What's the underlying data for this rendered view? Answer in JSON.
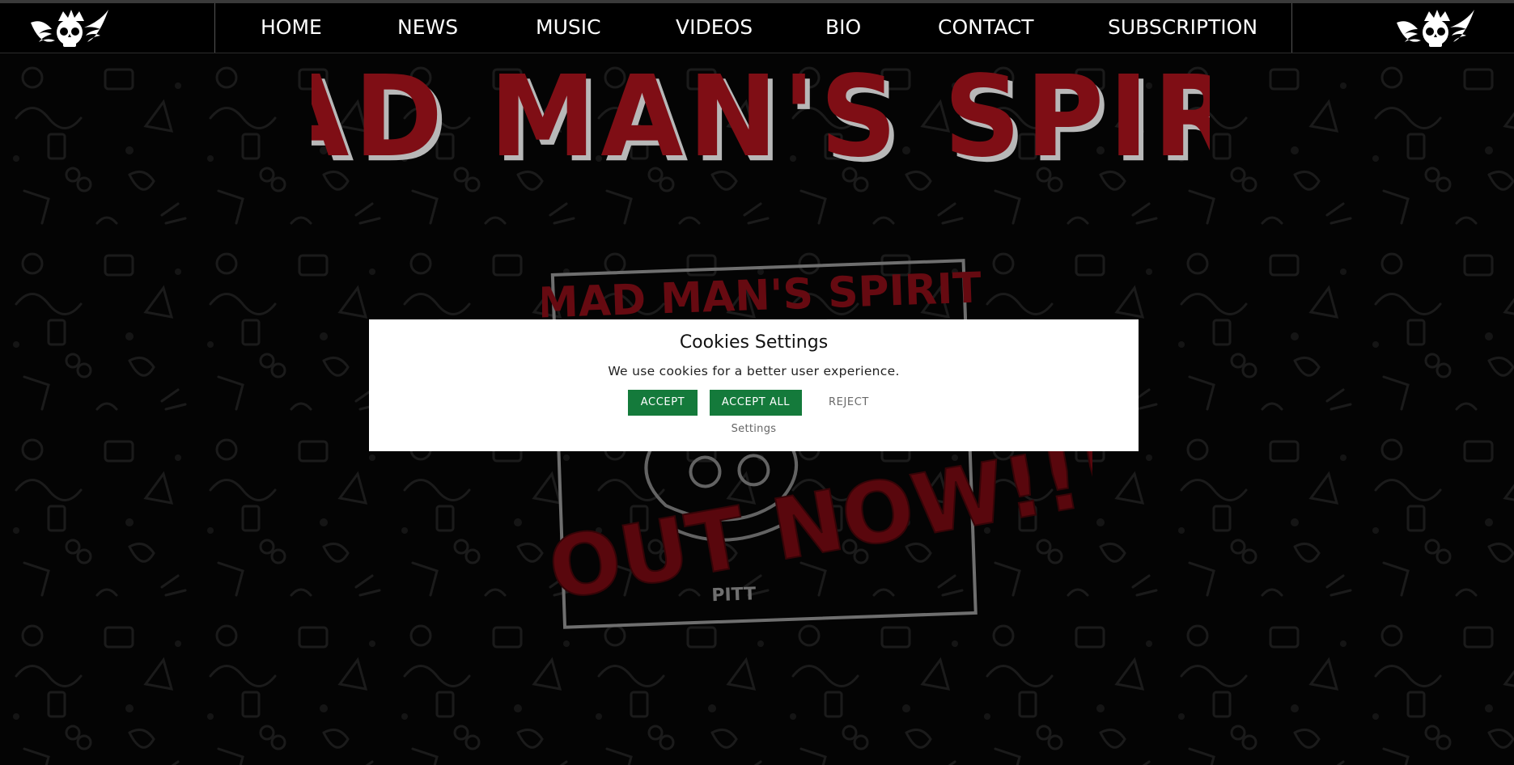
{
  "nav": {
    "items": [
      {
        "label": "HOME"
      },
      {
        "label": "NEWS"
      },
      {
        "label": "MUSIC"
      },
      {
        "label": "VIDEOS"
      },
      {
        "label": "BIO"
      },
      {
        "label": "CONTACT"
      },
      {
        "label": "SUBSCRIPTION"
      }
    ],
    "logo_icon": "winged-skull-crown-icon"
  },
  "hero": {
    "band_name": "MAD MAN'S SPIRIT",
    "cover_band_name": "MAD MAN'S SPIRIT",
    "cover_stamp": "OUT NOW!!!",
    "cover_small_text": "PITT"
  },
  "cookies": {
    "title": "Cookies Settings",
    "text": "We use cookies for a better user experience.",
    "accept_label": "ACCEPT",
    "accept_all_label": "ACCEPT ALL",
    "reject_label": "REJECT",
    "settings_label": "Settings"
  },
  "colors": {
    "accent_red": "#b0141e",
    "button_green": "#147a3b",
    "background": "#060606"
  }
}
